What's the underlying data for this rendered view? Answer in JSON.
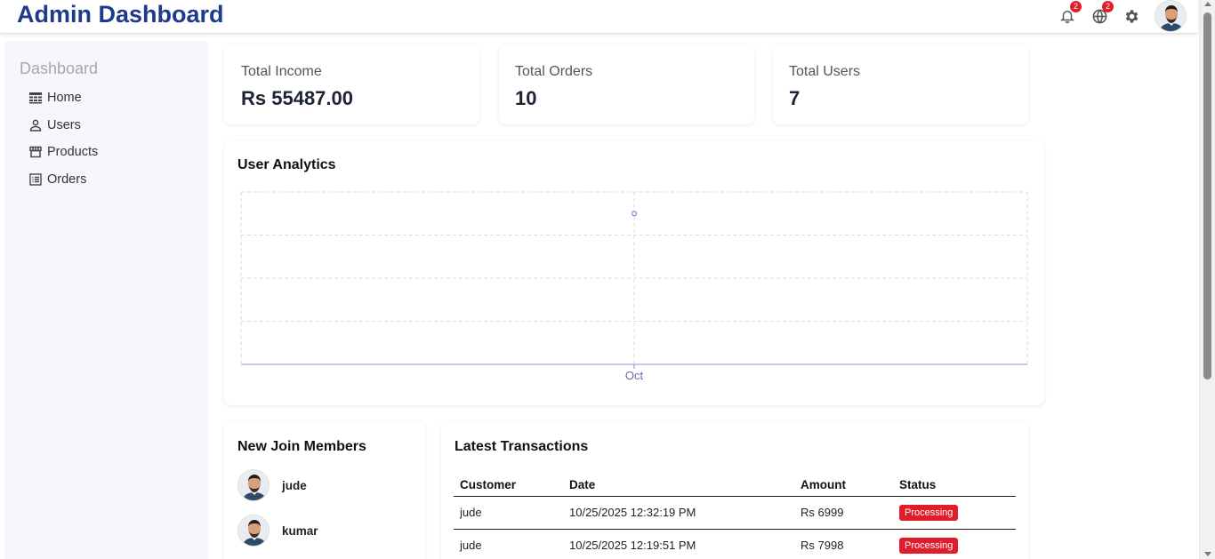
{
  "header": {
    "title": "Admin Dashboard",
    "notifications_count": "2",
    "messages_count": "2"
  },
  "sidebar": {
    "title": "Dashboard",
    "items": [
      {
        "label": "Home",
        "icon": "table-icon"
      },
      {
        "label": "Users",
        "icon": "user-icon"
      },
      {
        "label": "Products",
        "icon": "store-icon"
      },
      {
        "label": "Orders",
        "icon": "list-icon"
      }
    ]
  },
  "stats": [
    {
      "label": "Total Income",
      "value": "Rs 55487.00"
    },
    {
      "label": "Total Orders",
      "value": "10"
    },
    {
      "label": "Total Users",
      "value": "7"
    }
  ],
  "analytics": {
    "title": "User Analytics"
  },
  "chart_data": {
    "type": "line",
    "x": [
      "Oct"
    ],
    "series": [
      {
        "values": [
          7
        ]
      }
    ],
    "grid": true,
    "ylim": [
      0,
      8
    ],
    "color": "#8884d8"
  },
  "members": {
    "title": "New Join Members",
    "items": [
      {
        "name": "jude"
      },
      {
        "name": "kumar"
      }
    ]
  },
  "transactions": {
    "title": "Latest Transactions",
    "columns": [
      "Customer",
      "Date",
      "Amount",
      "Status"
    ],
    "rows": [
      {
        "customer": "jude",
        "date": "10/25/2025 12:32:19 PM",
        "amount": "Rs 6999",
        "status": "Processing"
      },
      {
        "customer": "jude",
        "date": "10/25/2025 12:19:51 PM",
        "amount": "Rs 7998",
        "status": "Processing"
      }
    ]
  },
  "colors": {
    "brand": "#1f3a8a",
    "status_processing": "#e11d2b",
    "chart_line": "#8884d8"
  }
}
